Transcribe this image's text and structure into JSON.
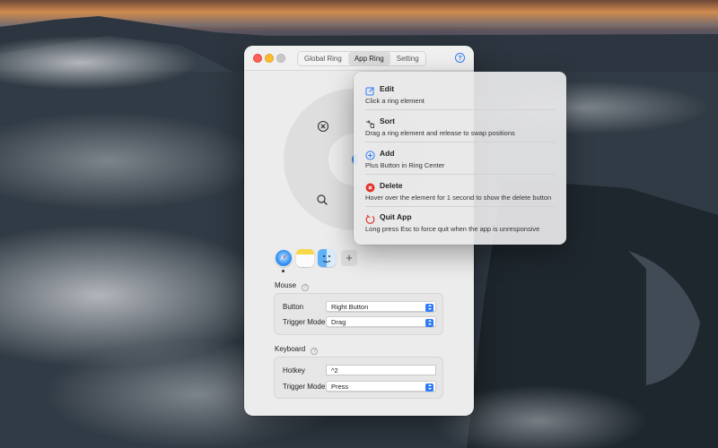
{
  "window": {
    "tabs": [
      {
        "label": "Global Ring",
        "active": false
      },
      {
        "label": "App Ring",
        "active": true
      },
      {
        "label": "Setting",
        "active": false
      }
    ],
    "help_icon": "question-circle-icon",
    "ring": {
      "icons": [
        "close-circle-icon",
        "search-icon"
      ]
    },
    "apps": [
      "Safari",
      "Notes",
      "Finder"
    ],
    "add_label": "+",
    "mouse": {
      "section_label": "Mouse",
      "button_label": "Button",
      "button_value": "Right Button",
      "trigger_label": "Trigger Mode",
      "trigger_value": "Drag"
    },
    "keyboard": {
      "section_label": "Keyboard",
      "hotkey_label": "Hotkey",
      "hotkey_value": "^2",
      "trigger_label": "Trigger Mode",
      "trigger_value": "Press"
    }
  },
  "popover": {
    "items": [
      {
        "title": "Edit",
        "desc": "Click a ring element",
        "icon": "edit-icon",
        "color": "#2f7cf6"
      },
      {
        "title": "Sort",
        "desc": "Drag a ring element and release to swap positions",
        "icon": "swap-hand-icon",
        "color": "#444444"
      },
      {
        "title": "Add",
        "desc": "Plus Button in Ring Center",
        "icon": "plus-circle-icon",
        "color": "#2f7cf6"
      },
      {
        "title": "Delete",
        "desc": "Hover over the element for 1 second to show the delete button",
        "icon": "delete-circle-icon",
        "color": "#e0342c"
      },
      {
        "title": "Quit App",
        "desc": "Long press Esc to force quit when the app is unresponsive",
        "icon": "quit-icon",
        "color": "#e0342c"
      }
    ]
  }
}
